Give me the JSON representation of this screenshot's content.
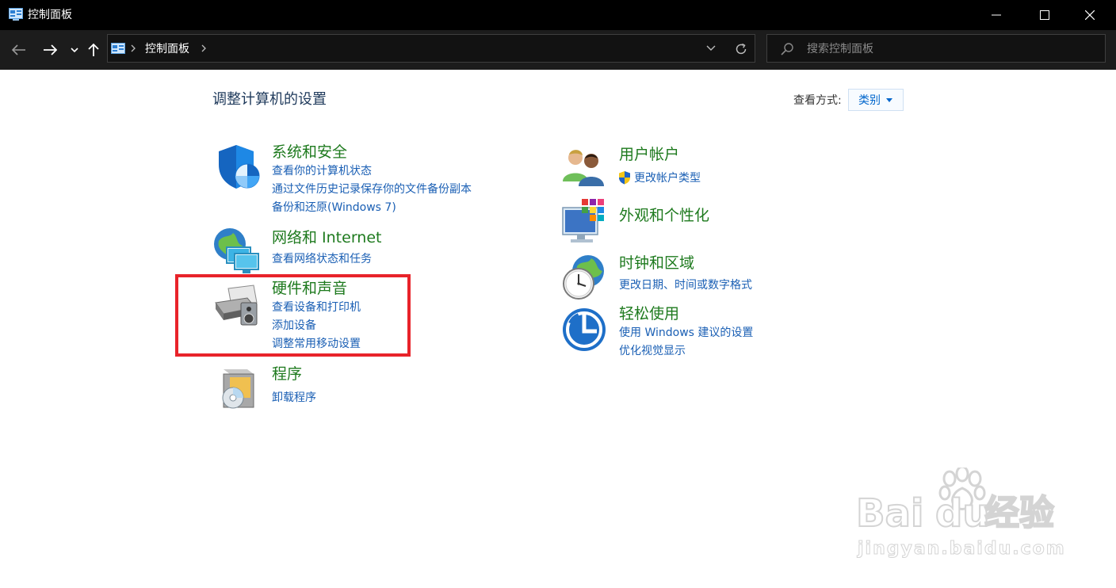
{
  "window": {
    "title": "控制面板"
  },
  "toolbar": {
    "breadcrumb": "控制面板",
    "search_placeholder": "搜索控制面板"
  },
  "page": {
    "title": "调整计算机的设置",
    "view_label": "查看方式:",
    "view_value": "类别"
  },
  "categories": [
    {
      "title": "系统和安全",
      "links": [
        "查看你的计算机状态",
        "通过文件历史记录保存你的文件备份副本",
        "备份和还原(Windows 7)"
      ]
    },
    {
      "title": "网络和 Internet",
      "links": [
        "查看网络状态和任务"
      ]
    },
    {
      "title": "硬件和声音",
      "links": [
        "查看设备和打印机",
        "添加设备",
        "调整常用移动设置"
      ]
    },
    {
      "title": "程序",
      "links": [
        "卸载程序"
      ]
    },
    {
      "title": "用户帐户",
      "links": [
        "更改帐户类型"
      ]
    },
    {
      "title": "外观和个性化",
      "links": []
    },
    {
      "title": "时钟和区域",
      "links": [
        "更改日期、时间或数字格式"
      ]
    },
    {
      "title": "轻松使用",
      "links": [
        "使用 Windows 建议的设置",
        "优化视觉显示"
      ]
    }
  ],
  "watermark": {
    "brand": "Bai",
    "brand2": "du",
    "brand_cn": "经验",
    "url": "jingyan.baidu.com"
  },
  "colors": {
    "accent_link": "#1a5fb4",
    "category_title": "#1e7a1e",
    "highlight": "#e8232a",
    "titlebar": "#000000"
  }
}
